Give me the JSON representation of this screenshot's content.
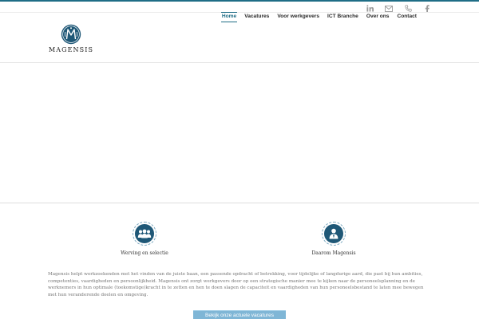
{
  "colors": {
    "brand": "#1f6d86",
    "icon_bg": "#1f5877",
    "cta_bg": "#7fb6d6"
  },
  "social": [
    {
      "icon": "linkedin-icon"
    },
    {
      "icon": "mail-icon"
    },
    {
      "icon": "phone-icon"
    },
    {
      "icon": "facebook-icon"
    }
  ],
  "logo": {
    "text": "MAGENSIS",
    "icon": "magensis-crest-logo"
  },
  "nav": {
    "items": [
      {
        "label": "Home",
        "active": true
      },
      {
        "label": "Vacatures"
      },
      {
        "label": "Voor werkgevers"
      },
      {
        "label": "ICT Branche"
      },
      {
        "label": "Over ons"
      },
      {
        "label": "Contact"
      }
    ]
  },
  "features": [
    {
      "label": "Werving en selectie",
      "icon": "group-icon"
    },
    {
      "label": "Daarom Magensis",
      "icon": "person-icon"
    }
  ],
  "intro": {
    "text": "Magensis helpt werkzoekenden met het vinden van de juiste baan, een passende opdracht of betrekking, voor tijdelijke of langdurige aard, die past bij hun ambities, competenties, vaardigheden en persoonlijkheid. Magensis ont zorgt werkgevers door op een strategische manier mee te kijken naar de personeelsplanning en de werknemers in hun optimale (toekomstige)kracht in te zetten en hen te doen slagen de capaciteit en vaardigheden van hun personeelsbestand te laten mee bewegen met hun veranderende doelen en omgeving."
  },
  "cta": {
    "label": "Bekijk onze actuele vacatures"
  }
}
